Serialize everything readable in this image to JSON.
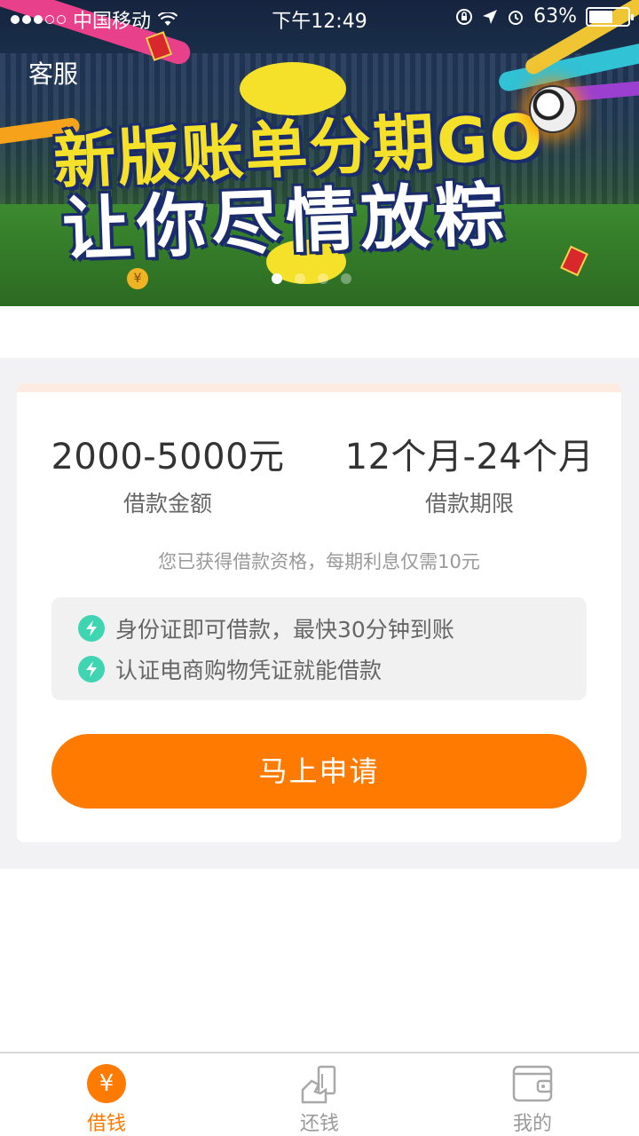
{
  "status_bar": {
    "carrier": "中国移动",
    "time": "下午12:49",
    "battery": "63%",
    "battery_level": 0.63
  },
  "header": {
    "service_link": "客服"
  },
  "banner": {
    "title": "新版账单分期GO",
    "subtitle": "让你尽情放粽",
    "slide_count": 4,
    "active_slide": 0
  },
  "loan": {
    "amount_value": "2000-5000元",
    "amount_label": "借款金额",
    "term_value": "12个月-24个月",
    "term_label": "借款期限",
    "notice": "您已获得借款资格，每期利息仅需10元",
    "features": [
      "身份证即可借款，最快30分钟到账",
      "认证电商购物凭证就能借款"
    ],
    "apply_button": "马上申请"
  },
  "tabs": [
    {
      "label": "借钱",
      "icon": "yen-icon",
      "active": true
    },
    {
      "label": "还钱",
      "icon": "repay-icon",
      "active": false
    },
    {
      "label": "我的",
      "icon": "wallet-icon",
      "active": false
    }
  ],
  "colors": {
    "accent": "#ff7a00",
    "feature_icon": "#3fd4b2",
    "card_stripe": "#fdebe2"
  }
}
